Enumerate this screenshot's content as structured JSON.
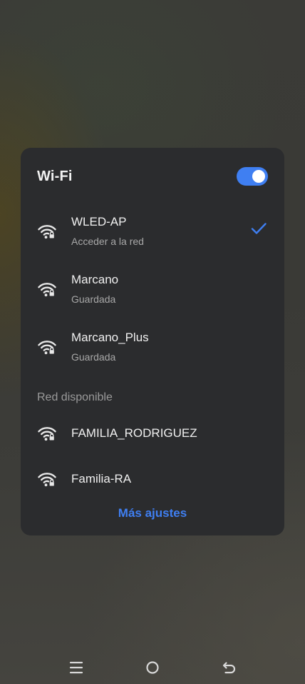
{
  "wifi_panel": {
    "title": "Wi-Fi",
    "toggle_state": "on",
    "accent_color": "#3f7ff2",
    "saved_networks": [
      {
        "name": "WLED-AP",
        "status": "Acceder a la red",
        "connected": true,
        "icon": "wifi-locked-icon"
      },
      {
        "name": "Marcano",
        "status": "Guardada",
        "connected": false,
        "icon": "wifi-locked-icon"
      },
      {
        "name": "Marcano_Plus",
        "status": "Guardada",
        "connected": false,
        "icon": "wifi-locked-icon"
      }
    ],
    "available_label": "Red disponible",
    "available_networks": [
      {
        "name": "FAMILIA_RODRIGUEZ",
        "icon": "wifi-locked-icon"
      },
      {
        "name": "Familia-RA",
        "icon": "wifi-locked-icon"
      }
    ],
    "more_settings_label": "Más ajustes"
  },
  "nav_bar": {
    "buttons": [
      "menu-icon",
      "home-icon",
      "back-icon"
    ]
  }
}
